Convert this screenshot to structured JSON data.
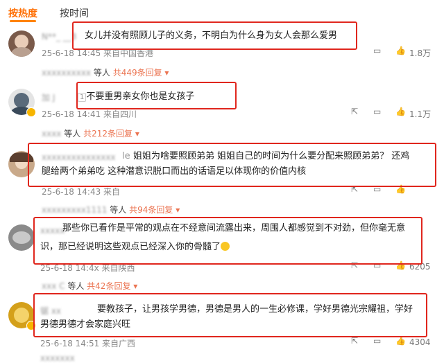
{
  "tabs": {
    "hot": "按热度",
    "time": "按时间"
  },
  "comments": [
    {
      "name": "N**_ __3",
      "text": "女儿并没有照顾儿子的义务，不明白为什么身为女人会那么爱男",
      "meta": "25-6-18 14:45 来自中国香港",
      "like": "1.8万",
      "reply_name": "xxxxxxxxxx",
      "reply_mid": "等人",
      "reply_count": "共449条回复",
      "avatar_color": "#7a5a4a"
    },
    {
      "name": "加 J",
      "text": "不要重男亲女你也是女孩子",
      "meta": "25-6-18 14:41 来自四川",
      "like": "1.1万",
      "reply_name": "xxxx",
      "reply_mid": "等人",
      "reply_count": "共212条回复",
      "avatar_color": "#5a6a7a"
    },
    {
      "name": "xxxxxxxxxxxxxxx",
      "name_suffix": "le",
      "text1": "姐姐为啥要照顾弟弟 姐姐自己的时间为什么要分配来照顾弟弟？  还鸡",
      "text2": "腿给两个弟弟吃 这种潜意识脱口而出的话语足以体现你的价值内核",
      "meta": "25-6-18 14:43 来自",
      "like": "",
      "reply_name": "xxxxxxxxx1111",
      "reply_mid": "等人",
      "reply_count": "共94条回复",
      "avatar_color": "#c9a98a"
    },
    {
      "name": "xxxxx",
      "text1": "那些你已看作是平常的观点在不经意间流露出来，周围人都感觉到不对劲，但你毫无意",
      "text2": "识，那已经说明这些观点已经深入你的骨髓了",
      "meta": "25-6-18 14:4x 来自陕西",
      "like": "6205",
      "reply_name": "xxx C",
      "reply_mid": "等人",
      "reply_count": "共42条回复",
      "avatar_color": "#8a8a8a"
    },
    {
      "name": "锯 xx",
      "text1": "要教孩子，让男孩学男德，男德是男人的一生必修课，学好男德光宗耀祖，学好",
      "text2": "男德男德才会家庭兴旺",
      "meta": "25-6-18 14:51 来自广西",
      "like": "4304",
      "reply_name": "xxxxxxx",
      "avatar_color": "#d4a01a"
    }
  ],
  "icons": [
    "share-icon",
    "comment-icon",
    "like-icon"
  ],
  "colors": {
    "accent": "#ff8200",
    "highlight_box": "#e0261d",
    "reply_count": "#eb7350"
  }
}
